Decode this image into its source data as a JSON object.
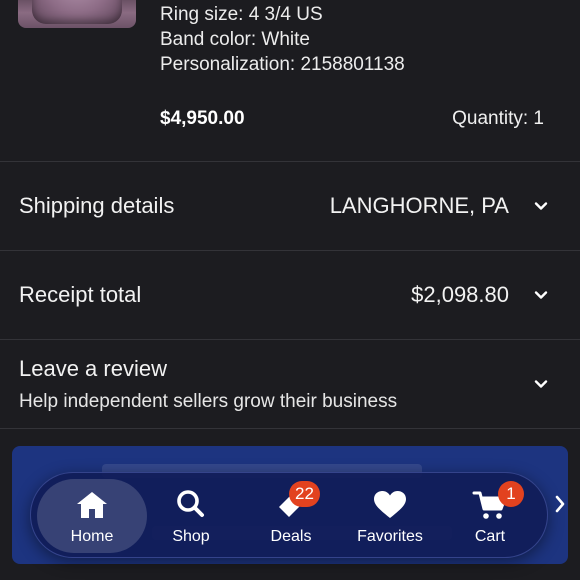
{
  "item": {
    "ring_size": "Ring size: 4 3/4 US",
    "band_color": "Band color: White",
    "personalization": "Personalization: 2158801138",
    "price": "$4,950.00",
    "quantity": "Quantity: 1"
  },
  "shipping": {
    "label": "Shipping details",
    "value": "LANGHORNE, PA"
  },
  "receipt": {
    "label": "Receipt total",
    "value": "$2,098.80"
  },
  "review": {
    "title": "Leave a review",
    "subtitle": "Help independent sellers grow their business"
  },
  "tabs": {
    "home": "Home",
    "shop": "Shop",
    "deals": "Deals",
    "deals_badge": "22",
    "favorites": "Favorites",
    "cart": "Cart",
    "cart_badge": "1"
  },
  "icons": [
    "chevron-down-icon",
    "home-icon",
    "search-icon",
    "tag-icon",
    "heart-icon",
    "cart-icon",
    "chevron-right-icon"
  ],
  "colors": {
    "background": "#1c1c20",
    "tabbar": "#1d3480",
    "badge": "#e2421f"
  }
}
